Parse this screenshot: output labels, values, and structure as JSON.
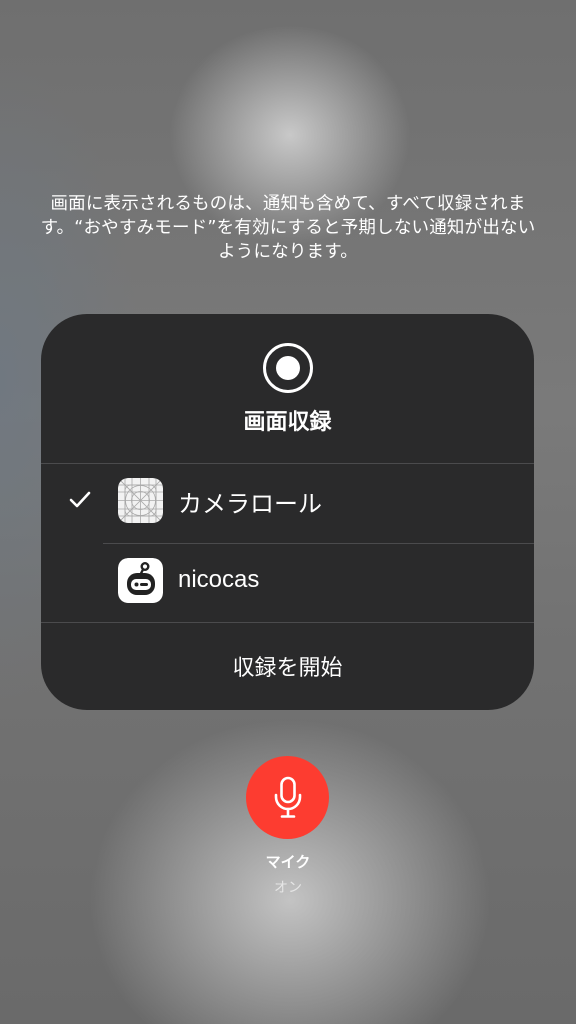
{
  "notice": {
    "text": "画面に表示されるものは、通知も含めて、すべて収録されます。“おやすみモード”を有効にすると予期しない通知が出ないようになります。"
  },
  "panel": {
    "title": "画面収録",
    "options": [
      {
        "label": "カメラロール",
        "selected": true,
        "icon": "camera-roll-icon"
      },
      {
        "label": "nicocas",
        "selected": false,
        "icon": "nicocas-app-icon"
      }
    ],
    "start_label": "収録を開始"
  },
  "mic": {
    "label": "マイク",
    "status": "オン",
    "color": "#fd3c30"
  },
  "colors": {
    "panel_bg": "#2a2a2b",
    "divider": "#4b4b4d",
    "accent_red": "#fd3c30"
  }
}
